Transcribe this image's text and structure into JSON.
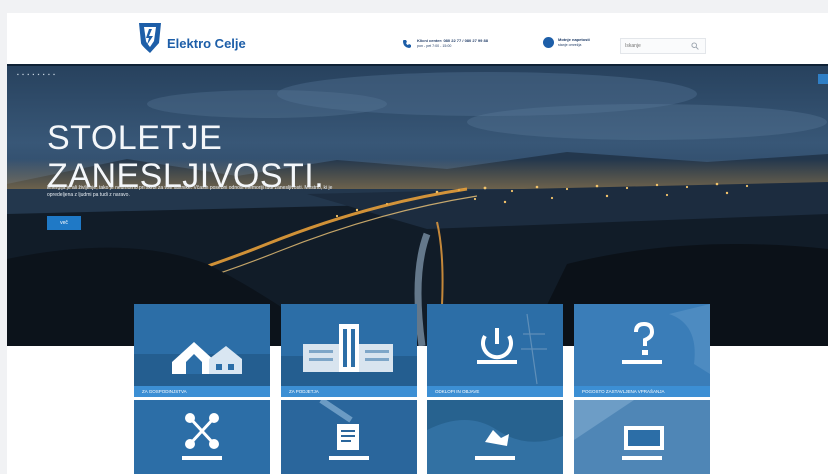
{
  "header": {
    "brand": "Elektro Celje",
    "contact": {
      "line1": "Klicni center: 080 22 77 / 080 27 99 88",
      "line2": "pon - pet 7:00 - 15:00"
    },
    "outage": {
      "line1": "Motnje napetosti",
      "line2": "stanje omrežja"
    },
    "search_placeholder": "Iskanje"
  },
  "hero": {
    "dots": "▪ ▪ ▪ ▪ ▪ ▪ ▪ ▪",
    "title_line1": "STOLETJE",
    "title_line2": "ZANESLJIVOSTI.",
    "text": "Energija je ali življenje, tako je neumorno pri skrbi za vse lastnike. Včasih posebni odnosi memoriji tudi zanesljivosti. Mestno, ki je opredeljena z ljudmi pa tudi z naravo.",
    "button": "več"
  },
  "tiles": [
    {
      "label": "ZA GOSPODINJSTVA",
      "icon": "house-icon"
    },
    {
      "label": "ZA PODJETJA",
      "icon": "building-icon"
    },
    {
      "label": "ODKLOPI IN OBJAVE",
      "icon": "power-icon"
    },
    {
      "label": "POGOSTO ZASTAVLJENA VPRAŠANJA",
      "icon": "question-icon"
    },
    {
      "label": "",
      "icon": "network-icon"
    },
    {
      "label": "",
      "icon": "document-icon"
    },
    {
      "label": "",
      "icon": "hand-icon"
    },
    {
      "label": "",
      "icon": "tablet-icon"
    }
  ],
  "colors": {
    "brand": "#1d5ea8",
    "accent": "#3c8fd4",
    "tile_bg": "#2c6ea7",
    "button": "#1f79c6"
  }
}
